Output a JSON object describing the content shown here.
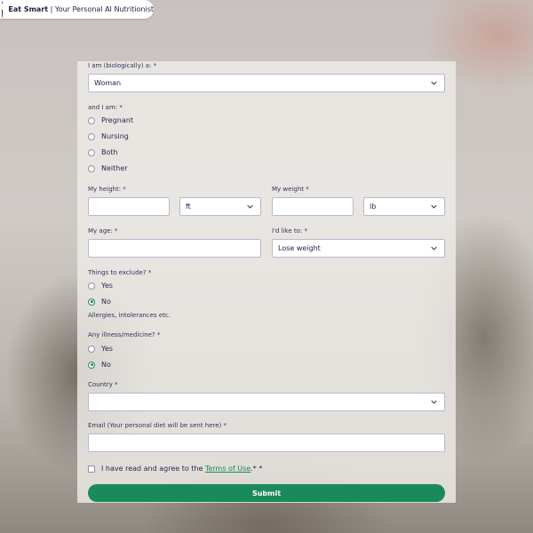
{
  "brand": {
    "name": "Eat Smart",
    "separator": " | ",
    "tagline": "Your Personal AI Nutritionist"
  },
  "form": {
    "sex": {
      "label": "I am (biologically) a: *",
      "value": "Woman"
    },
    "status": {
      "label": "and I am: *",
      "options": [
        "Pregnant",
        "Nursing",
        "Both",
        "Neither"
      ],
      "selected": null
    },
    "height": {
      "label": "My height: *",
      "value": "",
      "unit": "ft"
    },
    "weight": {
      "label": "My weight *",
      "value": "",
      "unit": "lb"
    },
    "age": {
      "label": "My age: *",
      "value": ""
    },
    "goal": {
      "label": "I'd like to: *",
      "value": "Lose weight"
    },
    "exclude": {
      "label": "Things to exclude? *",
      "options": [
        "Yes",
        "No"
      ],
      "selected": "No",
      "hint": "Allergies, intolerances etc."
    },
    "illness": {
      "label": "Any illness/medicine? *",
      "options": [
        "Yes",
        "No"
      ],
      "selected": "No"
    },
    "country": {
      "label": "Country *",
      "value": ""
    },
    "email": {
      "label": "Email (Your personal diet will be sent here) *",
      "value": ""
    },
    "terms": {
      "prefix": "I have read and agree to the ",
      "link": "Terms of Use",
      "suffix": ".* *",
      "checked": false
    },
    "submit_label": "Submit"
  },
  "colors": {
    "accent": "#1b8a5a",
    "text": "#262a4f",
    "border": "#b6b9cf"
  }
}
